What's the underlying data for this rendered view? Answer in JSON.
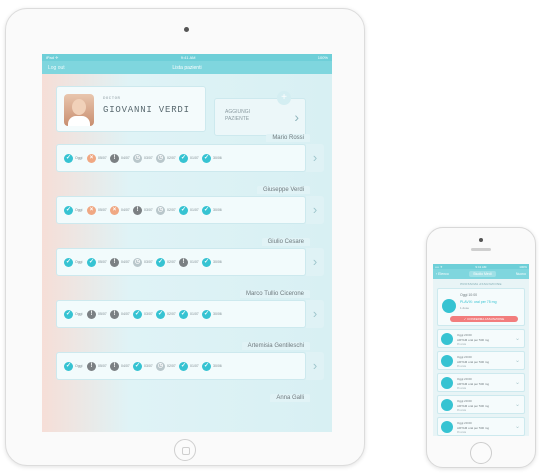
{
  "ipad": {
    "status": {
      "left": "iPad ✈",
      "center": "9:41 AM",
      "right": "100%"
    },
    "nav": {
      "back": "Log out",
      "title": "Lista pazienti"
    },
    "doctor": {
      "label": "DOCTOR",
      "name": "GIOVANNI VERDI"
    },
    "add_patient": {
      "plus": "+",
      "label": "AGGIUNGI PAZIENTE",
      "chevron": "›"
    },
    "patients": [
      {
        "name": "Mario Rossi",
        "days": [
          {
            "state": "ok",
            "label": "Oggi"
          },
          {
            "state": "missed",
            "label": "05/07"
          },
          {
            "state": "pending",
            "label": "04/07"
          },
          {
            "state": "late",
            "label": "03/07"
          },
          {
            "state": "late",
            "label": "02/07"
          },
          {
            "state": "ok",
            "label": "01/07"
          },
          {
            "state": "ok",
            "label": "30/06"
          }
        ]
      },
      {
        "name": "Giuseppe Verdi",
        "days": [
          {
            "state": "ok",
            "label": "Oggi"
          },
          {
            "state": "missed",
            "label": "05/07"
          },
          {
            "state": "missed",
            "label": "04/07"
          },
          {
            "state": "pending",
            "label": "03/07"
          },
          {
            "state": "late",
            "label": "02/07"
          },
          {
            "state": "ok",
            "label": "01/07"
          },
          {
            "state": "ok",
            "label": "30/06"
          }
        ]
      },
      {
        "name": "Giulio Cesare",
        "days": [
          {
            "state": "ok",
            "label": "Oggi"
          },
          {
            "state": "ok",
            "label": "05/07"
          },
          {
            "state": "pending",
            "label": "04/07"
          },
          {
            "state": "late",
            "label": "03/07"
          },
          {
            "state": "ok",
            "label": "02/07"
          },
          {
            "state": "pending",
            "label": "01/07"
          },
          {
            "state": "ok",
            "label": "30/06"
          }
        ]
      },
      {
        "name": "Marco Tullio Cicerone",
        "days": [
          {
            "state": "ok",
            "label": "Oggi"
          },
          {
            "state": "pending",
            "label": "05/07"
          },
          {
            "state": "pending",
            "label": "04/07"
          },
          {
            "state": "ok",
            "label": "03/07"
          },
          {
            "state": "ok",
            "label": "02/07"
          },
          {
            "state": "ok",
            "label": "01/07"
          },
          {
            "state": "ok",
            "label": "30/06"
          }
        ]
      },
      {
        "name": "Artemisia Gentileschi",
        "days": [
          {
            "state": "ok",
            "label": "Oggi"
          },
          {
            "state": "pending",
            "label": "05/07"
          },
          {
            "state": "pending",
            "label": "04/07"
          },
          {
            "state": "ok",
            "label": "03/07"
          },
          {
            "state": "late",
            "label": "02/07"
          },
          {
            "state": "ok",
            "label": "01/07"
          },
          {
            "state": "ok",
            "label": "30/06"
          }
        ]
      },
      {
        "name": "Anna Galli",
        "days": []
      }
    ],
    "dot_symbols": {
      "ok": "✓",
      "missed": "×",
      "pending": "!",
      "late": "◷"
    }
  },
  "iphone": {
    "status": {
      "left": "•••• ✈",
      "center": "9:41 AM",
      "right": "100%"
    },
    "nav": {
      "back": "‹ Elenco",
      "title": "Studio Medi",
      "right": "Nuovo"
    },
    "section": "PROSSIMA ASSUNZIONE",
    "next": {
      "time": "Oggi 10:00",
      "drug": "PLAVIX: oral per 75 mg",
      "qty": "1 dose",
      "confirm": "✓ CONFERMA ASSUNZIONE"
    },
    "items": [
      {
        "time": "Oggi 20:00",
        "drug": "ARTAM oral per 500 mg",
        "status": "Prevista"
      },
      {
        "time": "Oggi 20:00",
        "drug": "ARTAM oral per 500 mg",
        "status": "Prevista"
      },
      {
        "time": "Oggi 20:00",
        "drug": "ARTAM oral per 500 mg",
        "status": "Prevista"
      },
      {
        "time": "Oggi 20:00",
        "drug": "ARTAM oral per 500 mg",
        "status": "Prevista"
      },
      {
        "time": "Oggi 20:00",
        "drug": "ARTAM oral per 500 mg",
        "status": "Prevista"
      }
    ]
  }
}
